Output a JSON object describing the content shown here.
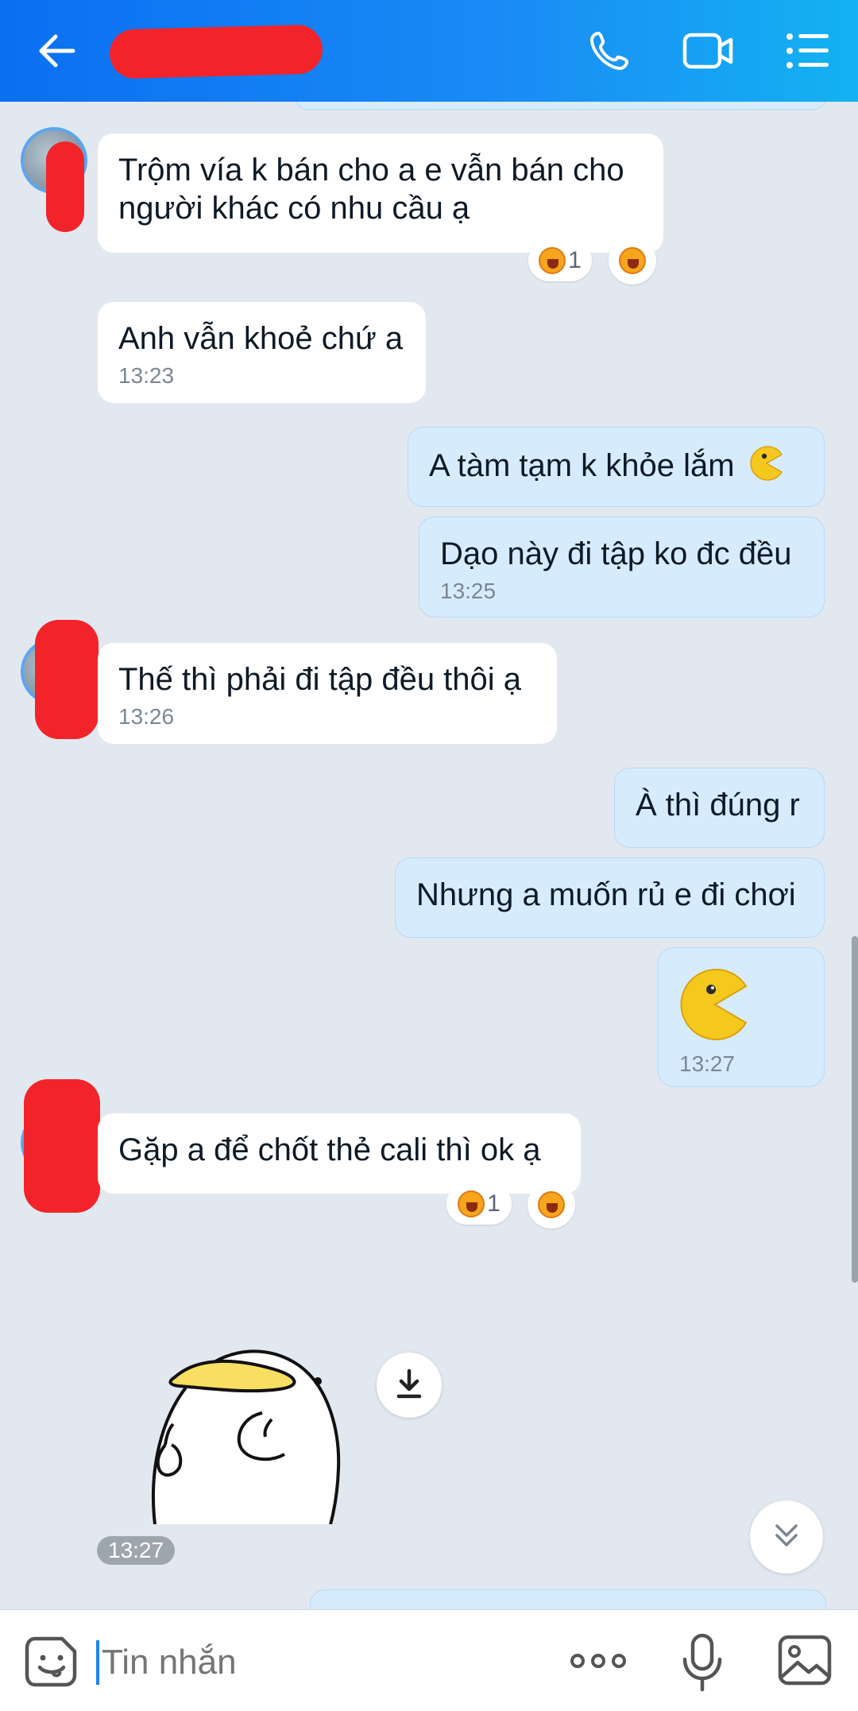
{
  "header": {
    "back_icon": "arrow-left-icon",
    "contact_name": "",
    "icons": [
      "phone-icon",
      "video-camera-icon",
      "menu-list-icon"
    ]
  },
  "messages": [
    {
      "text": "Trộm vía k bán cho a e vẫn bán cho người khác có nhu cầu ạ",
      "time": "",
      "reaction_count": "1"
    },
    {
      "text": "Anh vẫn khoẻ chứ a",
      "time": "13:23"
    },
    {
      "text": "A tàm tạm k khỏe lắm",
      "time": ""
    },
    {
      "text": "Dạo này đi tập ko đc đều",
      "time": "13:25"
    },
    {
      "text": "Thế thì phải đi tập đều thôi ạ",
      "time": "13:26"
    },
    {
      "text": "À thì đúng r",
      "time": ""
    },
    {
      "text": "Nhưng a muốn rủ e đi chơi",
      "time": ""
    },
    {
      "text": "",
      "time": "13:27"
    },
    {
      "text": "Gặp a để chốt thẻ cali thì ok ạ",
      "time": "",
      "reaction_count": "1"
    }
  ],
  "sticker": {
    "time": "13:27"
  },
  "composer": {
    "placeholder": "Tin nhắn",
    "icons": [
      "sticker-icon",
      "more-options-icon",
      "microphone-icon",
      "image-icon"
    ]
  },
  "colors": {
    "header_start": "#0a6ff2",
    "header_end": "#14b2f2",
    "chat_background": "#e2e8f0",
    "outgoing_bubble": "#d6ecfd",
    "incoming_bubble": "#ffffff",
    "redaction": "#f2242a"
  }
}
